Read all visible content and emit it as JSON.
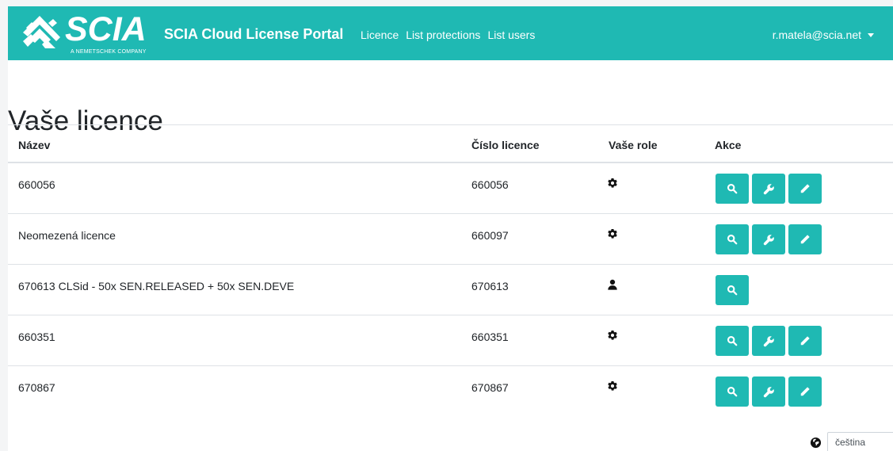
{
  "brand": {
    "logo_text": "SCIA",
    "logo_subtext": "A NEMETSCHEK COMPANY",
    "portal_title": "SCIA Cloud License Portal"
  },
  "nav": {
    "links": [
      "Licence",
      "List protections",
      "List users"
    ],
    "user_email": "r.matela@scia.net"
  },
  "page": {
    "title": "Vaše licence"
  },
  "table": {
    "headers": [
      "Název",
      "Číslo licence",
      "Vaše role",
      "Akce"
    ],
    "rows": [
      {
        "name": "660056",
        "number": "660056",
        "role": "gear-icon",
        "actions": [
          "search",
          "wrench",
          "pencil"
        ]
      },
      {
        "name": "Neomezená licence",
        "number": "660097",
        "role": "gear-icon",
        "actions": [
          "search",
          "wrench",
          "pencil"
        ]
      },
      {
        "name": "670613 CLSid - 50x SEN.RELEASED + 50x SEN.DEVE",
        "number": "670613",
        "role": "user-icon",
        "actions": [
          "search"
        ]
      },
      {
        "name": "660351",
        "number": "660351",
        "role": "gear-icon",
        "actions": [
          "search",
          "wrench",
          "pencil"
        ]
      },
      {
        "name": "670867",
        "number": "670867",
        "role": "gear-icon",
        "actions": [
          "search",
          "wrench",
          "pencil"
        ]
      }
    ]
  },
  "footer": {
    "language_value": "čeština"
  },
  "colors": {
    "accent": "#1fb9b3",
    "text": "#212529",
    "border": "#dee2e6"
  }
}
